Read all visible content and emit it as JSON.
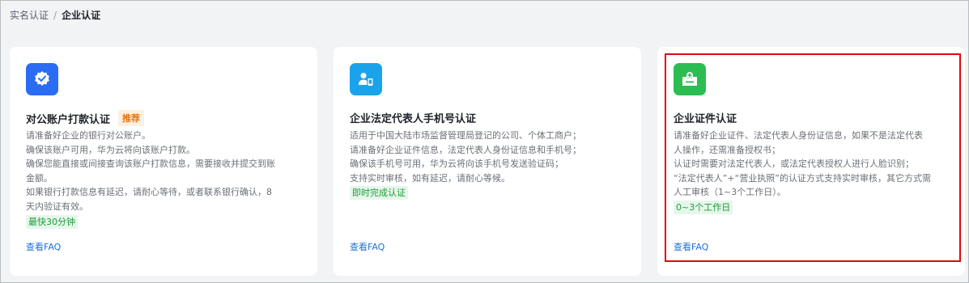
{
  "breadcrumb": {
    "items": [
      "实名认证",
      "企业认证"
    ],
    "separator": "/"
  },
  "colors": {
    "card1_icon_bg": "#2a6df4",
    "card2_icon_bg": "#1aa3ea",
    "card3_icon_bg": "#2bbd52",
    "highlight": "#e1060e"
  },
  "cards": [
    {
      "icon": "verified-badge-icon",
      "title": "对公账户打款认证",
      "badge": "推荐",
      "lines": [
        "请准备好企业的银行对公账户。",
        "确保该账户可用，华为云将向该账户打款。",
        "确保您能直接或间接查询该账户打款信息，需要接收并提交到账",
        "金额。",
        "如果银行打款信息有延迟，请耐心等待，或者联系银行确认，8",
        "天内验证有效。"
      ],
      "tag": "最快30分钟",
      "faq": "查看FAQ"
    },
    {
      "icon": "person-phone-icon",
      "title": "企业法定代表人手机号认证",
      "lines": [
        "适用于中国大陆市场监督管理局登记的公司、个体工商户；",
        "请准备好企业证件信息，法定代表人身份证信息和手机号；",
        "确保该手机号可用，华为云将向该手机号发送验证码；",
        "支持实时审核，如有延迟，请耐心等候。"
      ],
      "tag": "即时完成认证",
      "faq": "查看FAQ"
    },
    {
      "icon": "certificate-icon",
      "title": "企业证件认证",
      "lines": [
        "请准备好企业证件、法定代表人身份证信息，如果不是法定代表",
        "人操作，还需准备授权书；",
        "认证时需要对法定代表人，或法定代表授权人进行人脸识别；",
        "“法定代表人”+“营业执照”的认证方式支持实时审核，其它方式需",
        "人工审核（1~3个工作日）。"
      ],
      "tag": "0~3个工作日",
      "faq": "查看FAQ"
    }
  ]
}
